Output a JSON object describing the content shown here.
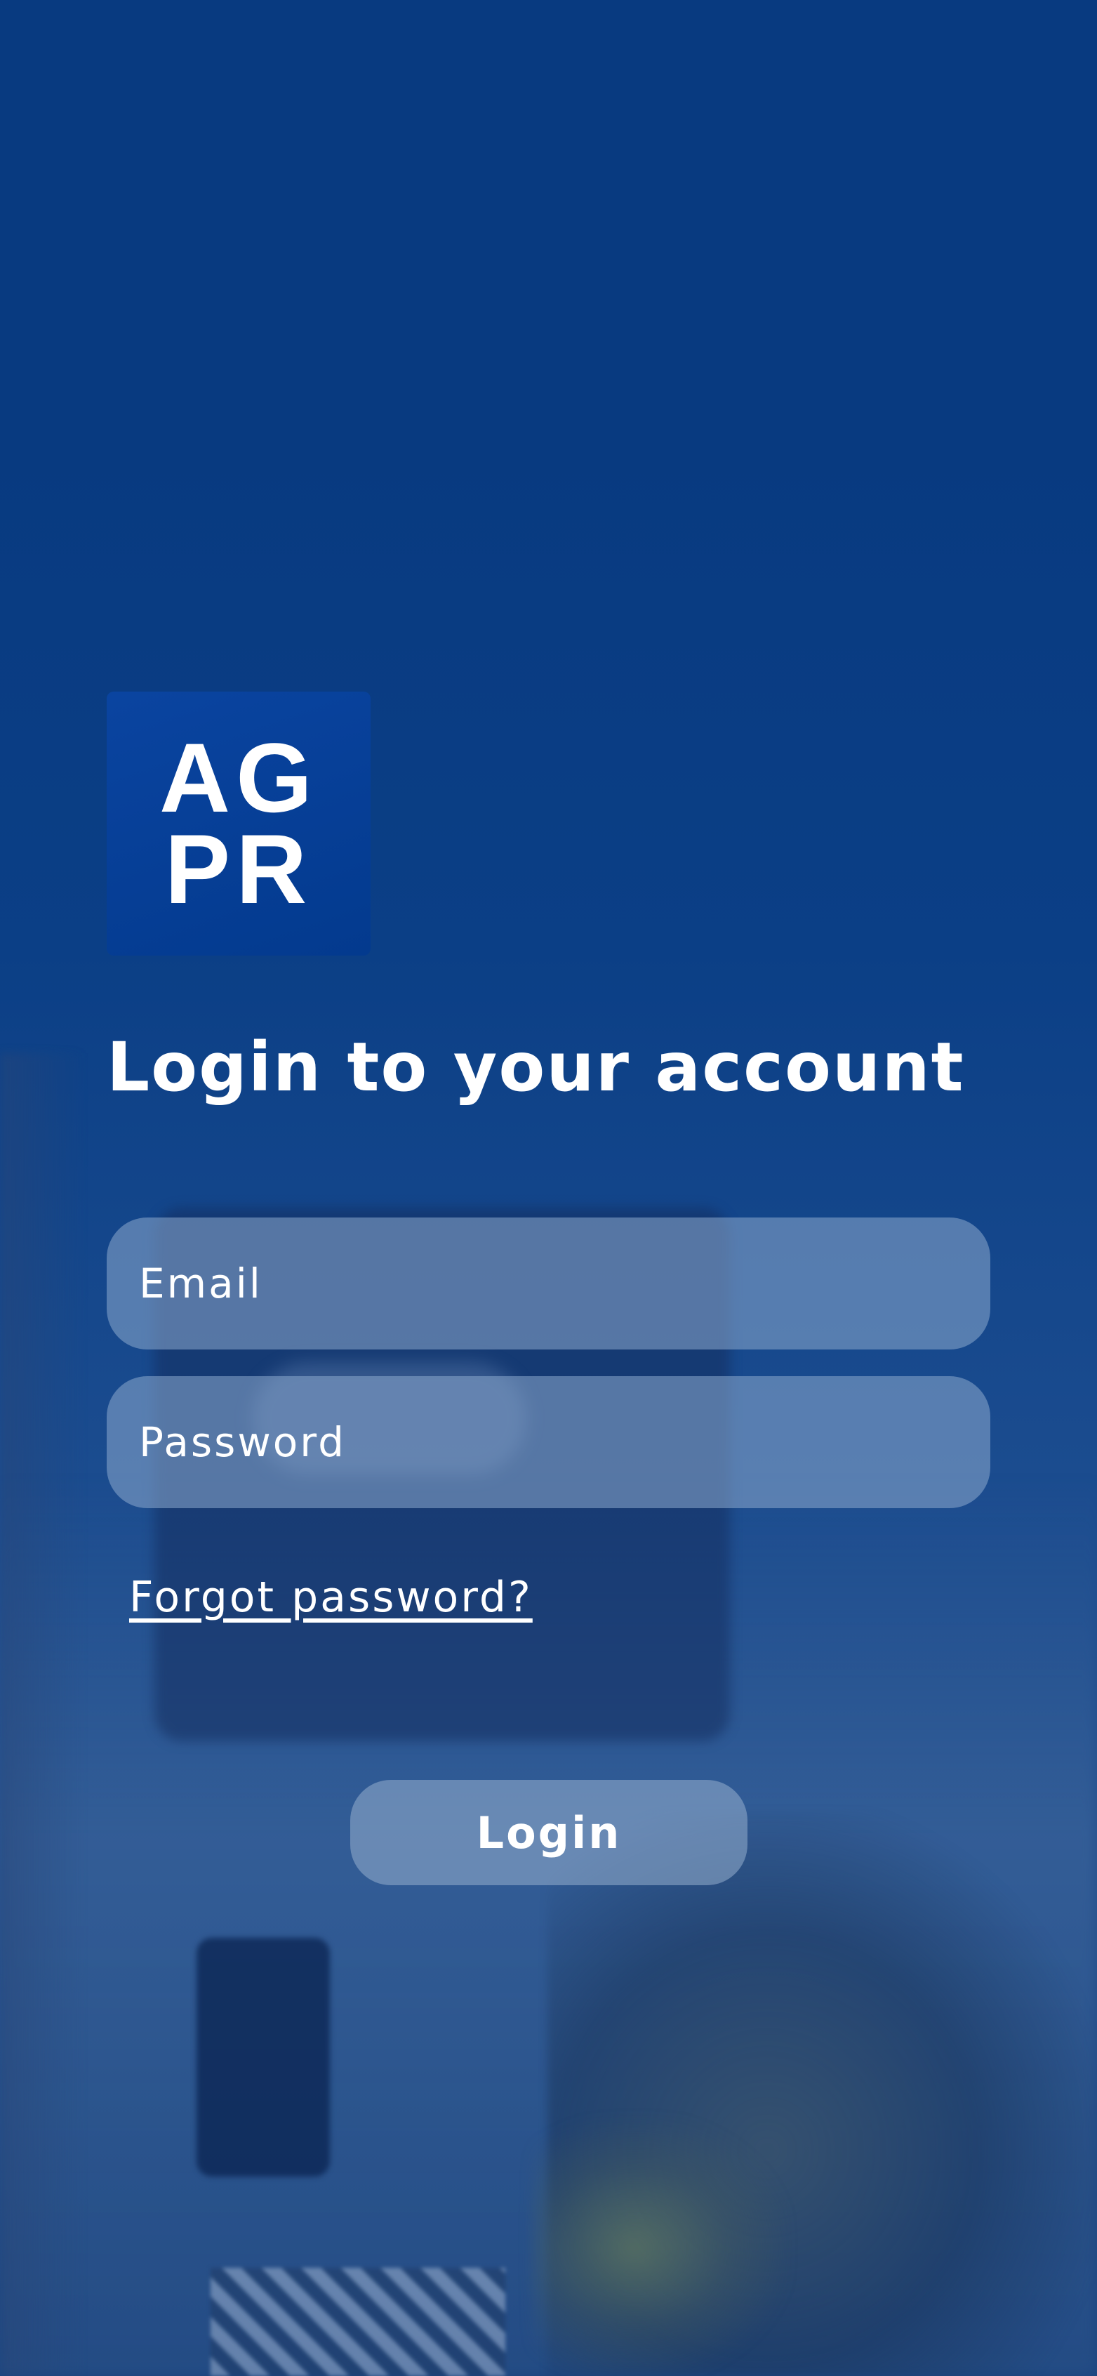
{
  "logo": {
    "line1": "AG",
    "line2": "PR"
  },
  "login": {
    "title": "Login to your account",
    "email_placeholder": "Email",
    "password_placeholder": "Password",
    "forgot_label": "Forgot password?",
    "button_label": "Login"
  },
  "colors": {
    "background": "#083a80",
    "logo_background": "#033a8e",
    "text": "#ffffff"
  }
}
